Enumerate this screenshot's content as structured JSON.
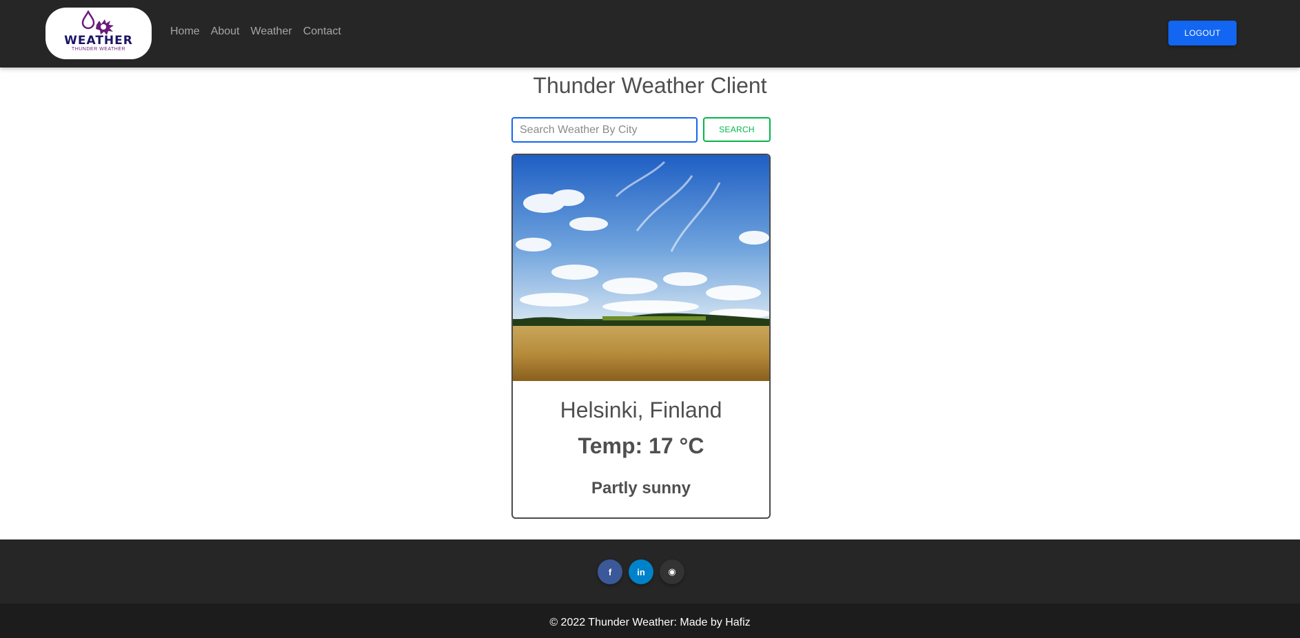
{
  "header": {
    "logo_word": "WEATHER",
    "logo_sub": "THUNDER WEATHER",
    "nav": [
      "Home",
      "About",
      "Weather",
      "Contact"
    ],
    "logout_label": "LOGOUT"
  },
  "main": {
    "title": "Thunder Weather Client",
    "search_placeholder": "Search Weather By City",
    "search_label": "SEARCH",
    "card": {
      "city": "Helsinki, Finland",
      "temp": "Temp: 17 °C",
      "condition": "Partly sunny"
    }
  },
  "footer": {
    "social": [
      {
        "icon": "facebook-icon",
        "glyph": "f",
        "color": "#3b5998"
      },
      {
        "icon": "linkedin-icon",
        "glyph": "in",
        "color": "#0082ca"
      },
      {
        "icon": "github-icon",
        "glyph": "◉",
        "color": "#333333"
      }
    ],
    "copyright": "© 2022 Thunder Weather: Made by Hafiz"
  },
  "colors": {
    "navbar": "#262626",
    "primary": "#1266f1",
    "success": "#00b74a"
  }
}
